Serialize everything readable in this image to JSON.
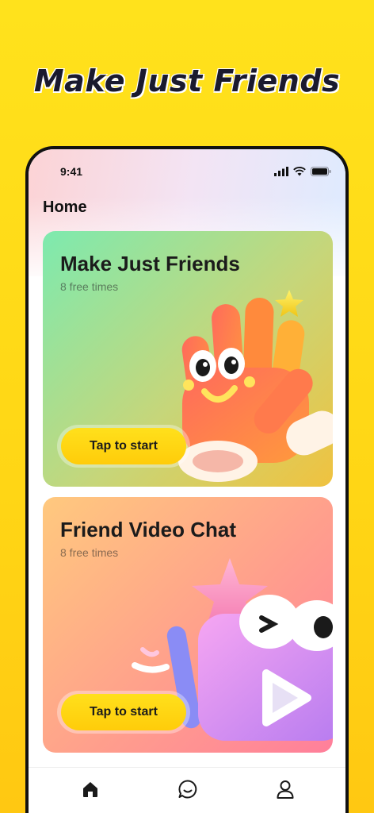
{
  "hero": {
    "title": "Make Just Friends"
  },
  "status_bar": {
    "time": "9:41"
  },
  "page": {
    "title": "Home"
  },
  "cards": [
    {
      "title": "Make Just Friends",
      "subtitle": "8 free times",
      "button": "Tap to start",
      "art_icon": "waving-hand-icon"
    },
    {
      "title": "Friend Video Chat",
      "subtitle": "8 free times",
      "button": "Tap to start",
      "art_icon": "video-play-icon"
    }
  ],
  "tab_bar": {
    "items": [
      "home-icon",
      "chat-icon",
      "profile-icon"
    ],
    "active": "home-icon"
  },
  "colors": {
    "accent": "#FFD615",
    "button": "#FFCC0A",
    "text": "#1b1b1b"
  }
}
